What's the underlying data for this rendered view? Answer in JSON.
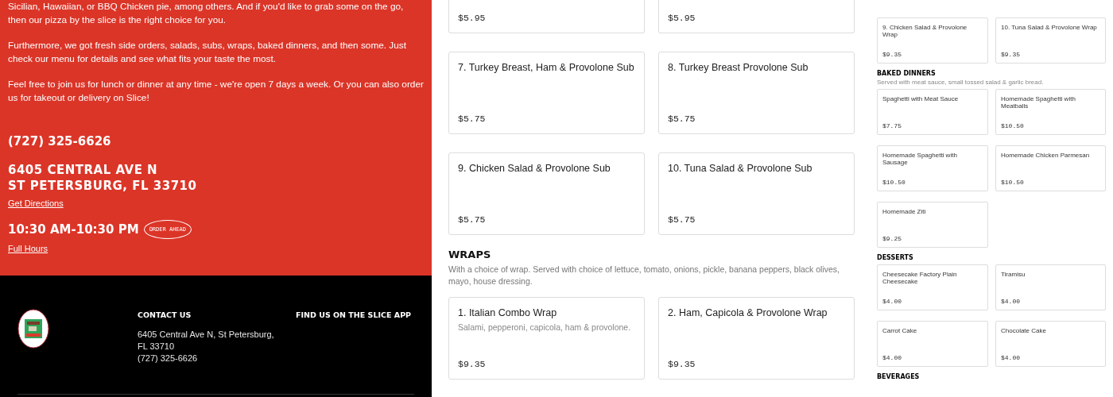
{
  "about": {
    "paragraphs": [
      "Sicilian, Hawaiian, or BBQ Chicken pie, among others. And if you'd like to grab some on the go, then our pizza by the slice is the right choice for you.",
      "Furthermore, we got fresh side orders, salads, subs, wraps, baked dinners, and then some. Just check our menu for details and see what fits your taste the most.",
      "Feel free to join us for lunch or dinner at any time - we're open 7 days a week. Or you can also order us for takeout or delivery on Slice!"
    ],
    "phone": "(727) 325-6626",
    "address_lines": [
      "6405 CENTRAL AVE N",
      "ST PETERSBURG, FL 33710"
    ],
    "directions_link": "Get Directions",
    "hours": "10:30 AM-10:30 PM",
    "order_badge": "ORDER AHEAD",
    "hours_link": "Full Hours"
  },
  "footer": {
    "contact_heading": "CONTACT US",
    "contact_address": "6405 Central Ave N, St Petersburg, FL 33710",
    "contact_phone": "(727) 325-6626",
    "app_heading": "FIND US ON THE SLICE APP"
  },
  "menu": {
    "partial_cards": [
      {
        "price": "$5.95"
      },
      {
        "price": "$5.95"
      }
    ],
    "cards": [
      {
        "name": "7. Turkey Breast, Ham & Provolone Sub",
        "price": "$5.75"
      },
      {
        "name": "8. Turkey Breast Provolone Sub",
        "price": "$5.75"
      },
      {
        "name": "9. Chicken Salad & Provolone Sub",
        "price": "$5.75"
      },
      {
        "name": "10. Tuna Salad & Provolone Sub",
        "price": "$5.75"
      }
    ],
    "sections": [
      {
        "title": "WRAPS",
        "description": "With a choice of wrap. Served with choice of lettuce, tomato, onions, pickle, banana peppers, black olives, mayo, house dressing.",
        "items": [
          {
            "name": "1. Italian Combo Wrap",
            "description": "Salami, pepperoni, capicola, ham & provolone.",
            "price": "$9.35"
          },
          {
            "name": "2. Ham, Capicola & Provolone Wrap",
            "price": "$9.35"
          }
        ]
      }
    ]
  },
  "mini_menu": {
    "cards": [
      {
        "name": "9. Chicken Salad & Provolone Wrap",
        "price": "$9.35"
      },
      {
        "name": "10. Tuna Salad & Provolone Wrap",
        "price": "$9.35"
      }
    ],
    "sections": [
      {
        "title": "BAKED DINNERS",
        "description": "Served with meat sauce, small tossed salad & garlic bread.",
        "items": [
          {
            "name": "Spaghetti with Meat Sauce",
            "price": "$7.75"
          },
          {
            "name": "Homemade Spaghetti with Meatballs",
            "price": "$10.50"
          },
          {
            "name": "Homemade Spaghetti with Sausage",
            "price": "$10.50"
          },
          {
            "name": "Homemade Chicken Parmesan",
            "price": "$10.50"
          },
          {
            "name": "Homemade Ziti",
            "price": "$9.25"
          }
        ]
      },
      {
        "title": "DESSERTS",
        "items": [
          {
            "name": "Cheesecake Factory Plain Cheesecake",
            "price": "$4.00"
          },
          {
            "name": "Tiramisu",
            "price": "$4.00"
          },
          {
            "name": "Carrot Cake",
            "price": "$4.00"
          },
          {
            "name": "Chocolate Cake",
            "price": "$4.00"
          }
        ]
      },
      {
        "title": "BEVERAGES"
      }
    ]
  }
}
